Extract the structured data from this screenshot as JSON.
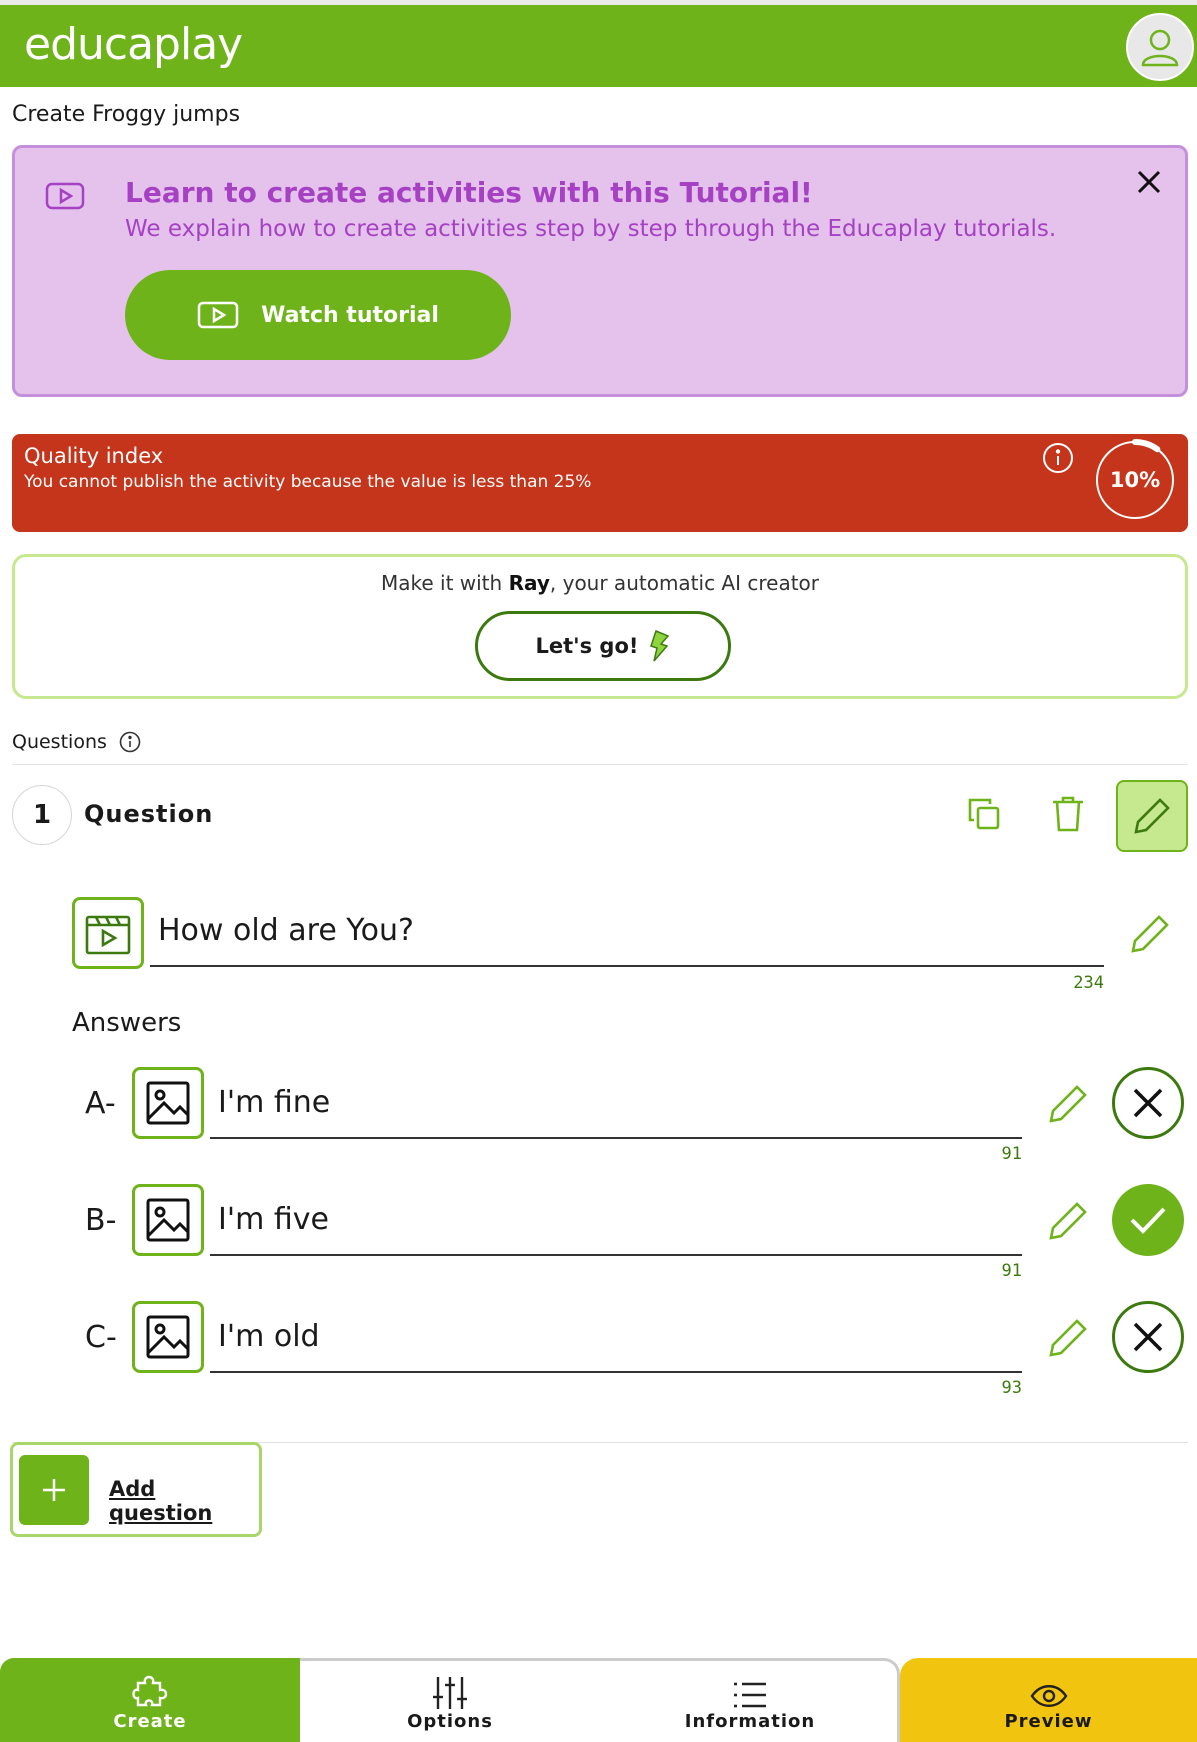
{
  "header": {
    "logo": "educaplay"
  },
  "page": {
    "title": "Create Froggy jumps"
  },
  "tutorial": {
    "title": "Learn to create activities with this Tutorial!",
    "subtitle": "We explain how to create activities step by step through the Educaplay tutorials.",
    "button": "Watch tutorial"
  },
  "quality": {
    "title": "Quality index",
    "message": "You cannot publish the activity because the value is less than 25%",
    "value_text": "10%",
    "value": 0.1
  },
  "ray": {
    "prefix": "Make it with ",
    "name": "Ray",
    "suffix": ", your automatic AI creator",
    "button": "Let's go!"
  },
  "questions": {
    "section_label": "Questions",
    "items": [
      {
        "number": "1",
        "heading": "Question",
        "text": "How old are You?",
        "counter": "234",
        "answers_label": "Answers",
        "answers": [
          {
            "letter": "A-",
            "text": "I'm fine",
            "counter": "91",
            "correct": false
          },
          {
            "letter": "B-",
            "text": "I'm five",
            "counter": "91",
            "correct": true
          },
          {
            "letter": "C-",
            "text": "I'm old",
            "counter": "93",
            "correct": false
          }
        ]
      }
    ],
    "add_label": "Add question"
  },
  "nav": {
    "tabs": [
      {
        "label": "Create",
        "icon": "puzzle-icon",
        "active": true
      },
      {
        "label": "Options",
        "icon": "sliders-icon",
        "active": false
      },
      {
        "label": "Information",
        "icon": "list-icon",
        "active": false
      },
      {
        "label": "Preview",
        "icon": "eye-icon",
        "active": false
      }
    ]
  },
  "colors": {
    "brand_green": "#6fb31b",
    "tutorial_bg": "#e4c2ec",
    "tutorial_text": "#a541c2",
    "quality_bg": "#c4351b",
    "preview_yellow": "#f1c40f"
  }
}
